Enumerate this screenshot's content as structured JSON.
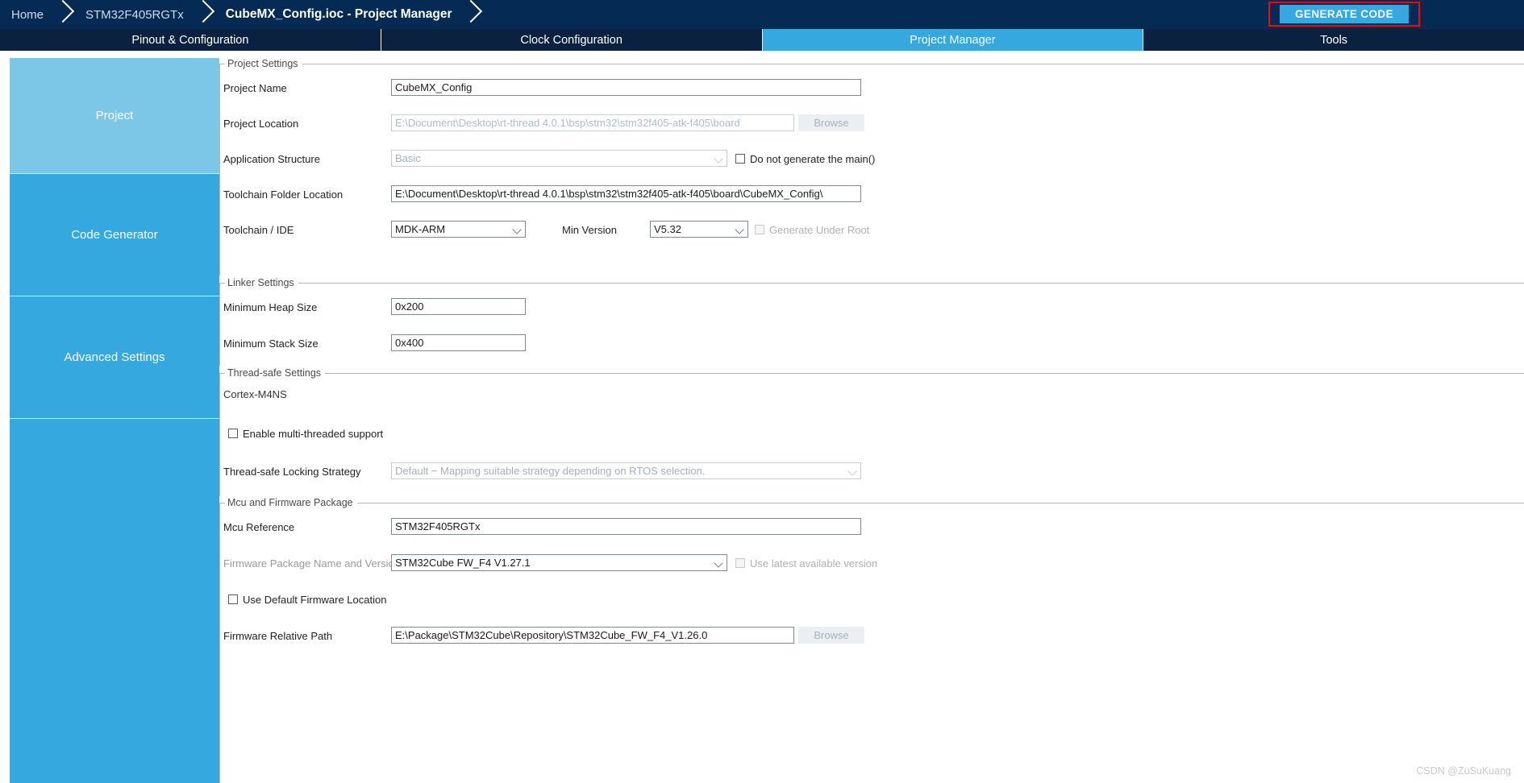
{
  "breadcrumb": {
    "items": [
      {
        "label": "Home",
        "active": false
      },
      {
        "label": "STM32F405RGTx",
        "active": false
      },
      {
        "label": "CubeMX_Config.ioc - Project Manager",
        "active": true
      }
    ]
  },
  "toolbar": {
    "generate_code_label": "GENERATE CODE",
    "highlight_color": "#ff0000",
    "accent_color": "#35a8e0"
  },
  "tabs": [
    {
      "label": "Pinout & Configuration",
      "active": false
    },
    {
      "label": "Clock Configuration",
      "active": false
    },
    {
      "label": "Project Manager",
      "active": true
    },
    {
      "label": "Tools",
      "active": false
    }
  ],
  "sidebar": {
    "items": [
      {
        "label": "Project",
        "selected": true
      },
      {
        "label": "Code Generator",
        "selected": false
      },
      {
        "label": "Advanced Settings",
        "selected": false
      },
      {
        "label": "",
        "selected": false
      }
    ]
  },
  "project_settings": {
    "legend": "Project Settings",
    "project_name": {
      "label": "Project Name",
      "value": "CubeMX_Config"
    },
    "project_location": {
      "label": "Project Location",
      "value": "E:\\Document\\Desktop\\rt-thread 4.0.1\\bsp\\stm32\\stm32f405-atk-f405\\board",
      "browse_label": "Browse"
    },
    "application_structure": {
      "label": "Application Structure",
      "value": "Basic",
      "checkbox_label": "Do not generate the main()",
      "checked": false
    },
    "toolchain_folder_location": {
      "label": "Toolchain Folder Location",
      "value": "E:\\Document\\Desktop\\rt-thread 4.0.1\\bsp\\stm32\\stm32f405-atk-f405\\board\\CubeMX_Config\\"
    },
    "toolchain_ide": {
      "label": "Toolchain / IDE",
      "value": "MDK-ARM",
      "min_version_label": "Min Version",
      "min_version_value": "V5.32",
      "generate_under_root_label": "Generate Under Root",
      "generate_under_root_checked": false
    }
  },
  "linker_settings": {
    "legend": "Linker Settings",
    "minimum_heap_size": {
      "label": "Minimum Heap Size",
      "value": "0x200"
    },
    "minimum_stack_size": {
      "label": "Minimum Stack Size",
      "value": "0x400"
    }
  },
  "thread_safe_settings": {
    "legend": "Thread-safe Settings",
    "core_label": "Cortex-M4NS",
    "enable_multithread": {
      "label": "Enable multi-threaded support",
      "checked": false
    },
    "locking_strategy": {
      "label": "Thread-safe Locking Strategy",
      "value": "Default  −  Mapping suitable strategy depending on RTOS selection."
    }
  },
  "mcu_firmware_package": {
    "legend": "Mcu and Firmware Package",
    "mcu_reference": {
      "label": "Mcu Reference",
      "value": "STM32F405RGTx"
    },
    "firmware_package": {
      "label": "Firmware Package Name and Version",
      "value": "STM32Cube FW_F4 V1.27.1",
      "checkbox_label": "Use latest available version",
      "checked": false
    },
    "use_default_firmware_location": {
      "label": "Use Default Firmware Location",
      "checked": false
    },
    "firmware_relative_path": {
      "label": "Firmware Relative Path",
      "value": "E:\\Package\\STM32Cube\\Repository\\STM32Cube_FW_F4_V1.26.0",
      "browse_label": "Browse"
    }
  },
  "watermark": {
    "text": "CSDN @ZuSuKuang"
  }
}
